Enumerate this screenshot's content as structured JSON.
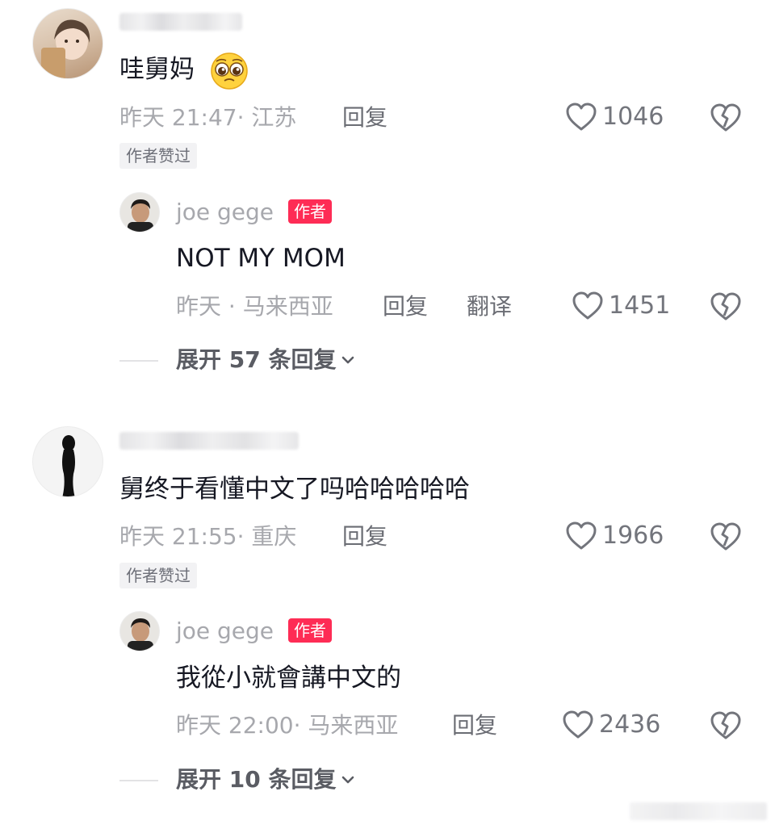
{
  "comments": [
    {
      "text": "哇舅妈",
      "emoji": "pleading-face",
      "time": "昨天 21:47",
      "location": "· 江苏",
      "reply_label": "回复",
      "likes": "1046",
      "liked_badge": "作者赞过",
      "author_reply": {
        "name": "joe gege",
        "badge": "作者",
        "text": "NOT MY MOM",
        "time": "昨天",
        "location": "· 马来西亚",
        "reply_label": "回复",
        "translate_label": "翻译",
        "likes": "1451"
      },
      "expand_label": "展开 57 条回复"
    },
    {
      "text": "舅终于看懂中文了吗哈哈哈哈哈",
      "time": "昨天 21:55",
      "location": "· 重庆",
      "reply_label": "回复",
      "likes": "1966",
      "liked_badge": "作者赞过",
      "author_reply": {
        "name": "joe gege",
        "badge": "作者",
        "text": "我從小就會講中文的",
        "time": "昨天 22:00",
        "location": "· 马来西亚",
        "reply_label": "回复",
        "likes": "2436"
      },
      "expand_label": "展开 10 条回复"
    }
  ],
  "icons": {
    "like": "heart-outline-icon",
    "dislike": "broken-heart-icon",
    "expand": "chevron-down-icon"
  }
}
